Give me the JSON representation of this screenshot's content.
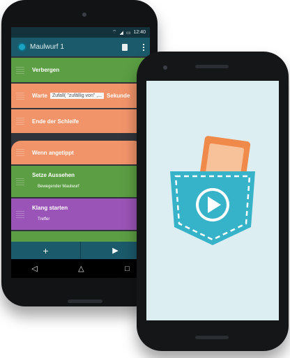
{
  "status_bar": {
    "time": "12:40"
  },
  "toolbar": {
    "title": "Maulwurf 1",
    "delete_icon": "trash-icon",
    "menu_icon": "more-vert-icon"
  },
  "bricks": [
    {
      "label": "Verbergen",
      "color": "#5b9e43"
    },
    {
      "label": "Warte",
      "field": "Zufall( \"zufällig von\" ,...",
      "suffix": "Sekunde",
      "color": "#f2946a"
    },
    {
      "label": "Ende der Schleife",
      "color": "#f2946a"
    },
    {
      "label": "Wenn angetippt",
      "color": "#f2946a"
    },
    {
      "label": "Setze Aussehen",
      "sub": "Bewegender Maulwurf",
      "color": "#5b9e43"
    },
    {
      "label": "Klang starten",
      "sub": "Treffer",
      "color": "#9a54b7"
    }
  ],
  "bottom_bar": {
    "add": "+",
    "play": "▶"
  },
  "nav": {
    "back": "◁",
    "home": "△",
    "recents": "□"
  },
  "logo": {
    "name": "pocket-code-logo",
    "pocket_color": "#36b3c8",
    "card_color": "#f08a4b"
  }
}
